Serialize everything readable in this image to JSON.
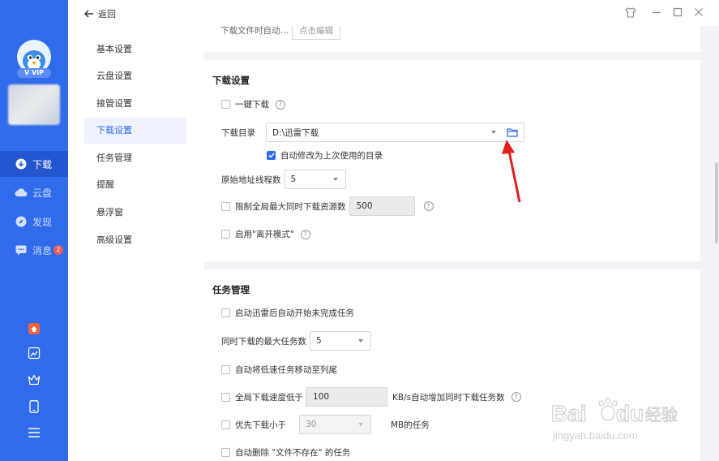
{
  "sidebar": {
    "vip_label": "V VIP",
    "nav": [
      {
        "label": "下载",
        "icon": "download-icon"
      },
      {
        "label": "云盘",
        "icon": "cloud-icon"
      },
      {
        "label": "发现",
        "icon": "compass-icon"
      },
      {
        "label": "消息",
        "icon": "message-icon",
        "badge": "2"
      }
    ],
    "tools": [
      "gift-icon",
      "image-icon",
      "crown-icon",
      "phone-icon",
      "menu-icon"
    ]
  },
  "topbar": {
    "back_label": "返回",
    "controls": [
      "skin-icon",
      "minimize-icon",
      "maximize-icon",
      "close-icon"
    ]
  },
  "settings_nav": {
    "items": [
      "基本设置",
      "云盘设置",
      "接管设置",
      "下载设置",
      "任务管理",
      "提醒",
      "悬浮窗",
      "高级设置"
    ],
    "active": "下载设置"
  },
  "top_card": {
    "partial_label": "下载文件时自动…",
    "partial_button": "点击编辑"
  },
  "download_settings": {
    "title": "下载设置",
    "one_click": "一键下载",
    "dir_label": "下载目录",
    "dir_value": "D:\\迅雷下载",
    "auto_change_dir": "自动修改为上次使用的目录",
    "threads_label": "原始地址线程数",
    "threads_value": "5",
    "limit_label": "限制全局最大同时下载资源数",
    "limit_value": "500",
    "leave_mode": "启用\"离开模式\""
  },
  "task_management": {
    "title": "任务管理",
    "auto_start": "启动迅雷后自动开始未完成任务",
    "max_tasks_label": "同时下载的最大任务数",
    "max_tasks_value": "5",
    "move_slow": "自动将低速任务移动至列尾",
    "speed_below_label": "全局下载速度低于",
    "speed_below_value": "100",
    "speed_below_suffix": "KB/s自动增加同时下载任务数",
    "priority_label": "优先下载小于",
    "priority_value": "30",
    "priority_suffix": "MB的任务",
    "auto_delete": "自动删除 \"文件不存在\" 的任务"
  },
  "watermark": {
    "brand": "Bai 经验",
    "url": "jingyan.baidu.com"
  }
}
